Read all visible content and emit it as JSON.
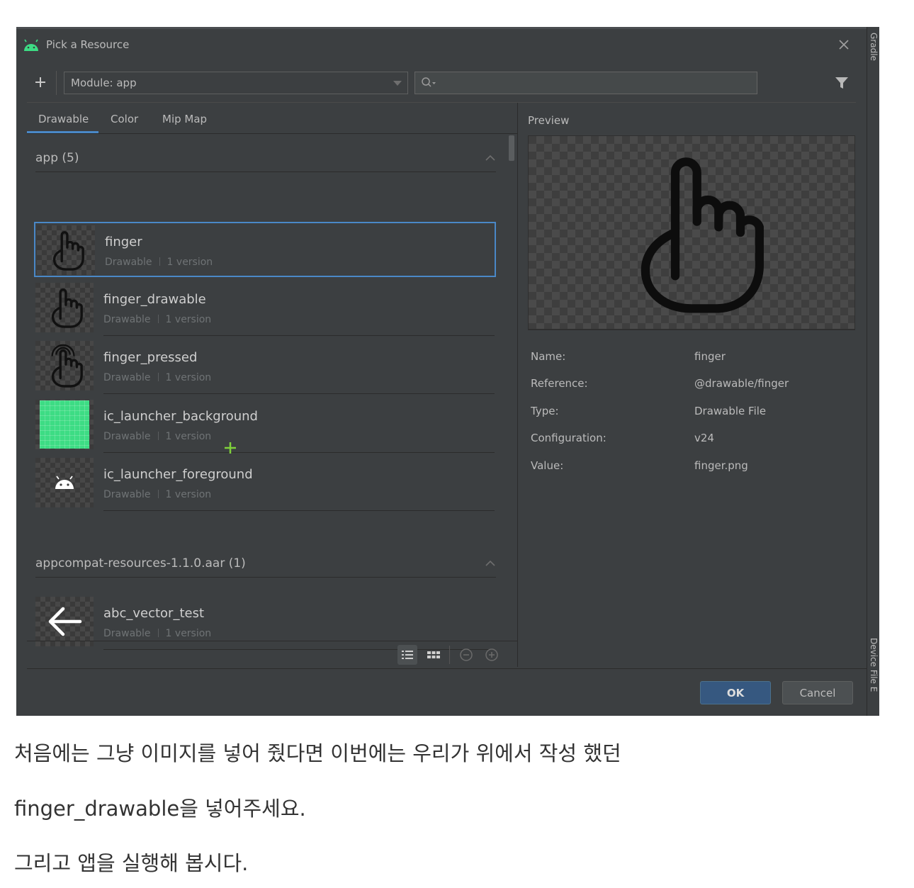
{
  "dialog": {
    "title": "Pick a Resource",
    "module_value": "Module: app",
    "search_value": "",
    "side_labels": {
      "top": "Gradle",
      "bottom": "Device File E"
    }
  },
  "tabs": [
    {
      "label": "Drawable",
      "active": true
    },
    {
      "label": "Color",
      "active": false
    },
    {
      "label": "Mip Map",
      "active": false
    }
  ],
  "groups": [
    {
      "title": "app (5)",
      "items": [
        {
          "name": "finger",
          "type": "Drawable",
          "versions": "1 version",
          "icon": "hand-pointer-icon",
          "selected": true
        },
        {
          "name": "finger_drawable",
          "type": "Drawable",
          "versions": "1 version",
          "icon": "hand-pointer-icon",
          "selected": false
        },
        {
          "name": "finger_pressed",
          "type": "Drawable",
          "versions": "1 version",
          "icon": "hand-pressed-icon",
          "selected": false
        },
        {
          "name": "ic_launcher_background",
          "type": "Drawable",
          "versions": "1 version",
          "icon": "green-grid-icon",
          "selected": false
        },
        {
          "name": "ic_launcher_foreground",
          "type": "Drawable",
          "versions": "1 version",
          "icon": "android-icon",
          "selected": false
        }
      ]
    },
    {
      "title": "appcompat-resources-1.1.0.aar (1)",
      "items": [
        {
          "name": "abc_vector_test",
          "type": "Drawable",
          "versions": "1 version",
          "icon": "arrow-left-icon",
          "selected": false
        }
      ]
    }
  ],
  "preview": {
    "label": "Preview",
    "properties": [
      {
        "label": "Name:",
        "value": "finger"
      },
      {
        "label": "Reference:",
        "value": "@drawable/finger"
      },
      {
        "label": "Type:",
        "value": "Drawable File"
      },
      {
        "label": "Configuration:",
        "value": "v24"
      },
      {
        "label": "Value:",
        "value": "finger.png"
      }
    ]
  },
  "buttons": {
    "ok": "OK",
    "cancel": "Cancel"
  },
  "colors": {
    "dialog_bg": "#3c3f41",
    "accent": "#4a88c7",
    "ok_bg": "#365880",
    "launcher_green": "#3ddc84"
  },
  "article": {
    "p1": "처음에는 그냥 이미지를 넣어 줬다면  이번에는 우리가  위에서 작성 했던",
    "p2": "finger_drawable을 넣어주세요.",
    "p3": "그리고 앱을 실행해 봅시다."
  }
}
